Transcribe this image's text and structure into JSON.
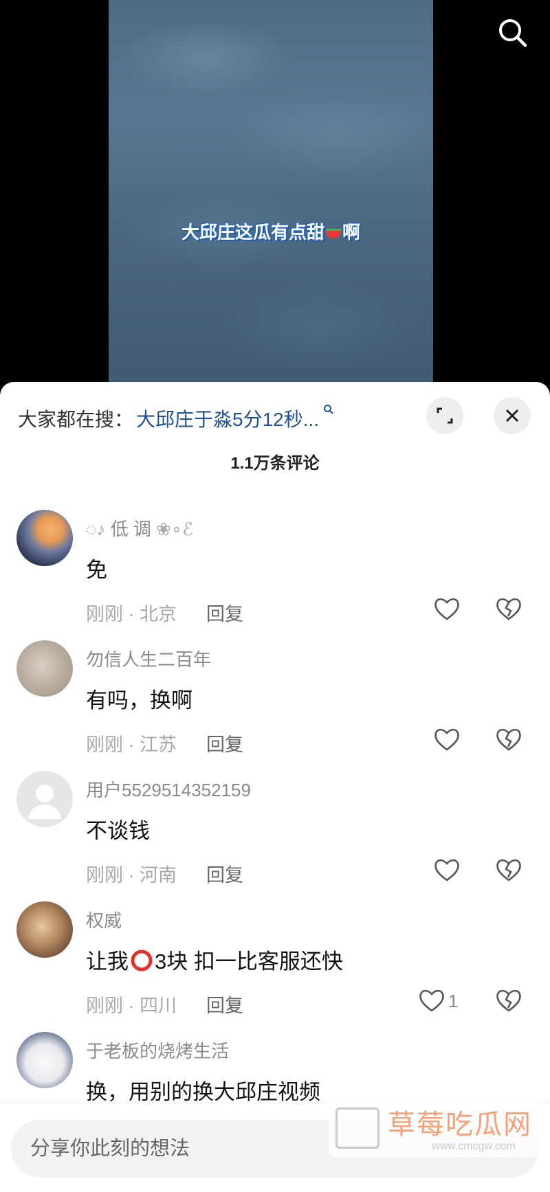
{
  "video": {
    "caption": "大邱庄这瓜有点甜",
    "caption_tail": "啊"
  },
  "sheet": {
    "search_prefix": "大家都在搜：",
    "search_query": "大邱庄于淼5分12秒...",
    "comment_count": "1.1万条评论"
  },
  "comments": [
    {
      "username": "低 调",
      "text": "免",
      "time": "刚刚",
      "location": "北京",
      "reply": "回复",
      "likes": ""
    },
    {
      "username": "勿信人生二百年",
      "text": "有吗，换啊",
      "time": "刚刚",
      "location": "江苏",
      "reply": "回复",
      "likes": ""
    },
    {
      "username": "用户5529514352159",
      "text": "不谈钱",
      "time": "刚刚",
      "location": "河南",
      "reply": "回复",
      "likes": ""
    },
    {
      "username": "权威",
      "text_before": "让我",
      "text_after": "3块 扣一比客服还快",
      "time": "刚刚",
      "location": "四川",
      "reply": "回复",
      "likes": "1"
    },
    {
      "username": "于老板的烧烤生活",
      "text": "换，用别的换大邱庄视频"
    }
  ],
  "input": {
    "placeholder": "分享你此刻的想法"
  },
  "watermark": {
    "title": "草莓吃瓜网",
    "sub": "www.cmcgw.com"
  },
  "icons": {
    "search": "search-icon",
    "expand": "expand-icon",
    "close": "close-icon",
    "like": "heart-icon",
    "dislike": "broken-heart-icon"
  }
}
